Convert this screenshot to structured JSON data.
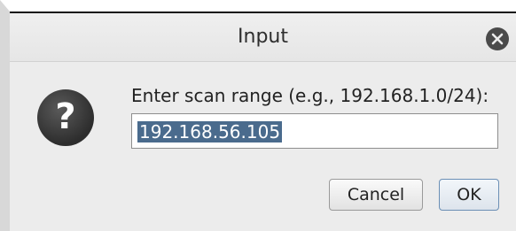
{
  "dialog": {
    "title": "Input",
    "prompt": "Enter scan range (e.g., 192.168.1.0/24):",
    "input_value": "192.168.56.105",
    "icon": "question-icon",
    "close_icon": "close-icon",
    "buttons": {
      "cancel": "Cancel",
      "ok": "OK"
    }
  }
}
